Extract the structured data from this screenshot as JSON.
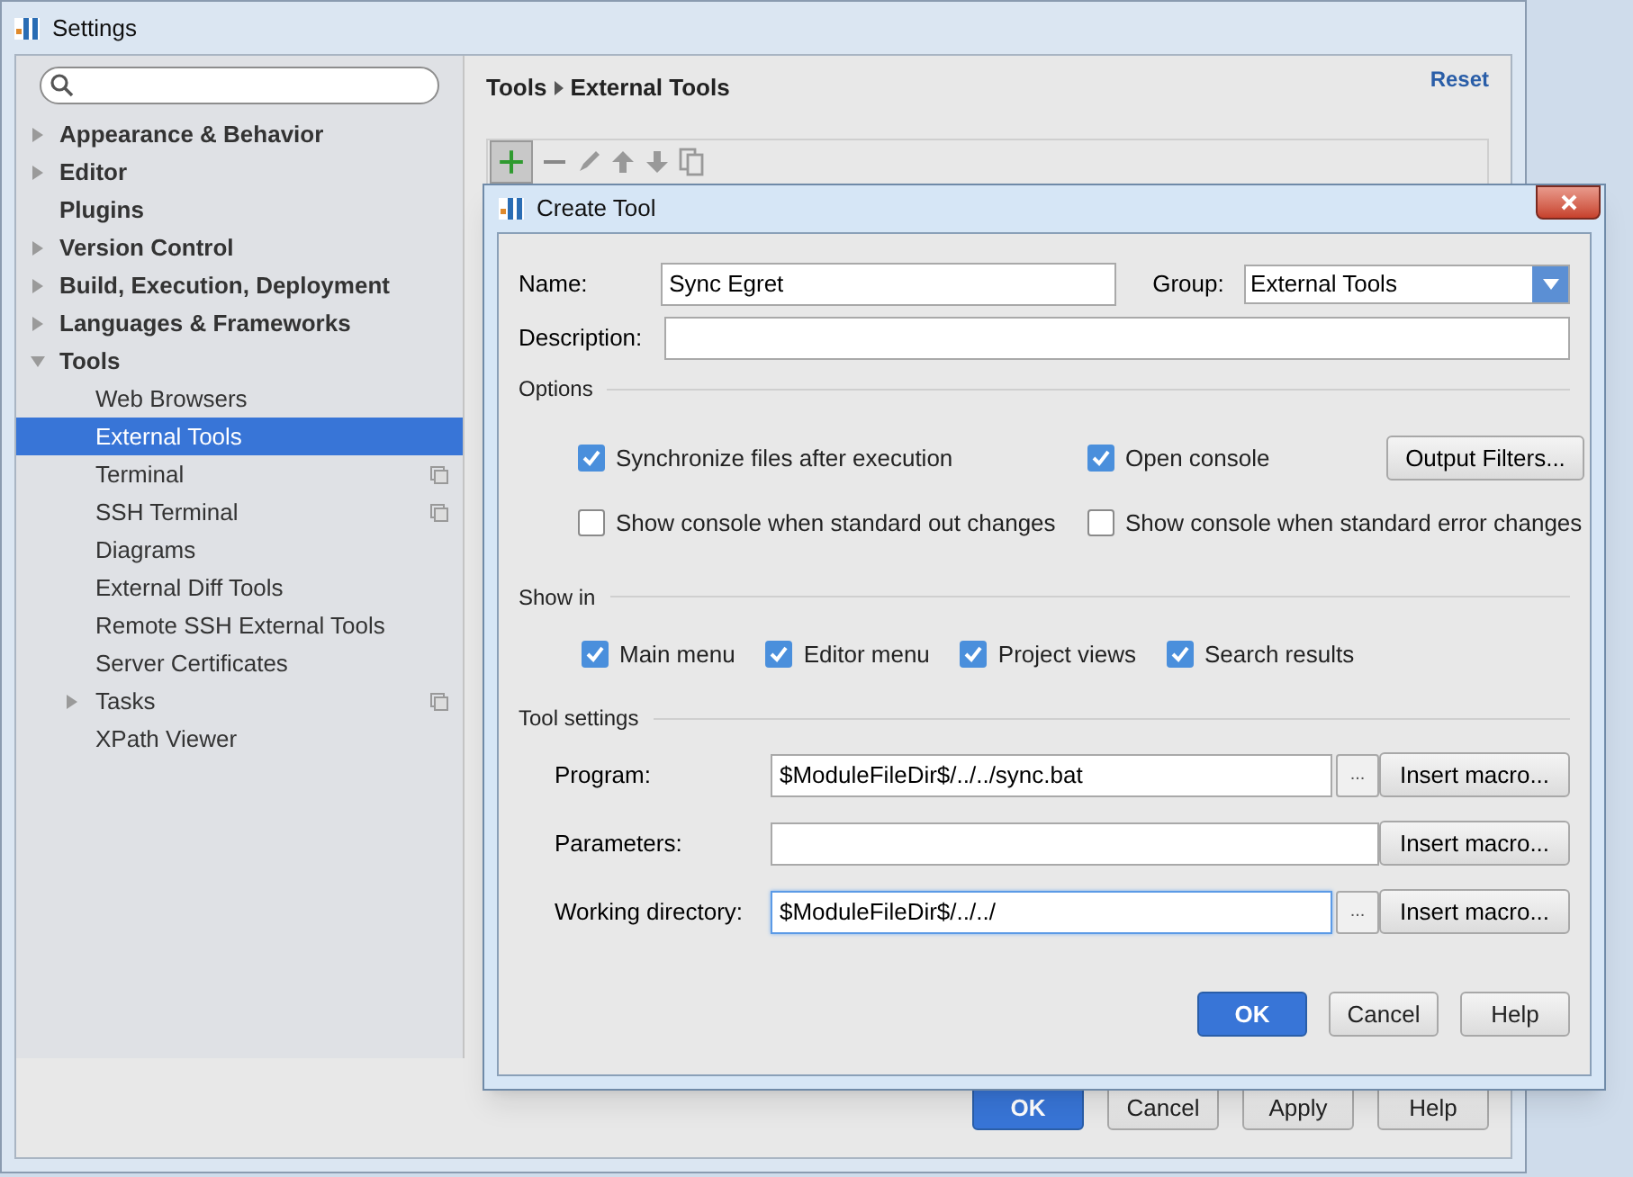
{
  "window": {
    "title": "Settings"
  },
  "sidebar": {
    "items": [
      {
        "label": "Appearance & Behavior",
        "expanded": false,
        "selected": false
      },
      {
        "label": "Editor",
        "expanded": false,
        "selected": false
      },
      {
        "label": "Plugins",
        "selected": false
      },
      {
        "label": "Version Control",
        "expanded": false,
        "selected": false
      },
      {
        "label": "Build, Execution, Deployment",
        "expanded": false,
        "selected": false
      },
      {
        "label": "Languages & Frameworks",
        "expanded": false,
        "selected": false
      },
      {
        "label": "Tools",
        "expanded": true,
        "selected": false,
        "children": [
          {
            "label": "Web Browsers",
            "selected": false,
            "project_scoped": false
          },
          {
            "label": "External Tools",
            "selected": true,
            "project_scoped": false
          },
          {
            "label": "Terminal",
            "selected": false,
            "project_scoped": true
          },
          {
            "label": "SSH Terminal",
            "selected": false,
            "project_scoped": true
          },
          {
            "label": "Diagrams",
            "selected": false,
            "project_scoped": false
          },
          {
            "label": "External Diff Tools",
            "selected": false,
            "project_scoped": false
          },
          {
            "label": "Remote SSH External Tools",
            "selected": false,
            "project_scoped": false
          },
          {
            "label": "Server Certificates",
            "selected": false,
            "project_scoped": false
          },
          {
            "label": "Tasks",
            "expanded": false,
            "selected": false,
            "project_scoped": true
          },
          {
            "label": "XPath Viewer",
            "selected": false,
            "project_scoped": false
          }
        ]
      }
    ]
  },
  "breadcrumb": [
    "Tools",
    "External Tools"
  ],
  "reset_link": "Reset",
  "dialog": {
    "title": "Create Tool",
    "name": {
      "label": "Name:",
      "value": "Sync Egret"
    },
    "group": {
      "label": "Group:",
      "value": "External Tools"
    },
    "description": {
      "label": "Description:"
    },
    "options": {
      "title": "Options",
      "checkboxes": [
        {
          "label": "Synchronize files after execution",
          "checked": true
        },
        {
          "label": "Open console",
          "checked": true
        },
        {
          "label": "Show console when standard out changes",
          "checked": false
        },
        {
          "label": "Show console when standard error changes",
          "checked": false
        }
      ],
      "filters_button": "Output Filters..."
    },
    "show_in": {
      "title": "Show in",
      "checkboxes": [
        {
          "label": "Main menu",
          "checked": true
        },
        {
          "label": "Editor menu",
          "checked": true
        },
        {
          "label": "Project views",
          "checked": true
        },
        {
          "label": "Search results",
          "checked": true
        }
      ]
    },
    "tool_settings": {
      "title": "Tool settings",
      "rows": [
        {
          "label": "Program:",
          "value": "$ModuleFileDir$/../../sync.bat",
          "browse": "...",
          "macro_button": "Insert macro...",
          "focused": false
        },
        {
          "label": "Parameters:",
          "macro_button": "Insert macro...",
          "focused": false
        },
        {
          "label": "Working directory:",
          "value": "$ModuleFileDir$/../../",
          "browse": "...",
          "macro_button": "Insert macro...",
          "focused": true
        }
      ]
    },
    "buttons": [
      {
        "label": "OK",
        "kind": "primary"
      },
      {
        "label": "Cancel",
        "kind": "default"
      },
      {
        "label": "Help",
        "kind": "default"
      }
    ]
  },
  "buttons": [
    {
      "label": "OK",
      "kind": "primary"
    },
    {
      "label": "Cancel",
      "kind": "default"
    },
    {
      "label": "Apply",
      "kind": "default"
    },
    {
      "label": "Help",
      "kind": "default"
    }
  ]
}
